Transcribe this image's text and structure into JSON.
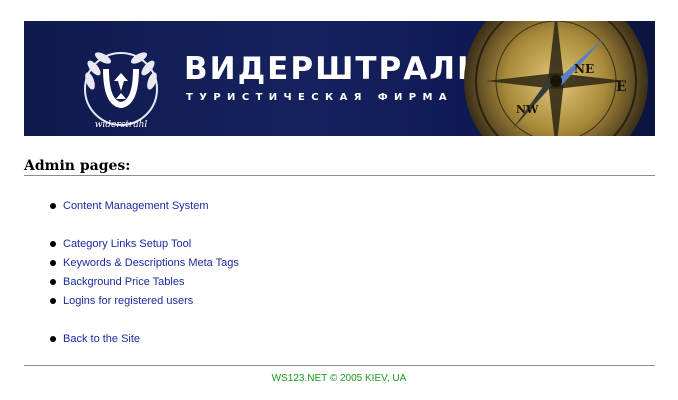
{
  "banner": {
    "title": "ВИДЕРШТРАЛЬ",
    "subtitle": "ТУРИСТИЧЕСКАЯ ФИРМА",
    "logo_text": "widerstrahl",
    "compass_labels": [
      "NE",
      "E",
      "NW"
    ],
    "colors": {
      "background": "#16225f",
      "accent": "#c9a445"
    }
  },
  "admin": {
    "heading": "Admin pages:"
  },
  "links": {
    "group1": [
      {
        "label": "Content Management System"
      }
    ],
    "group2": [
      {
        "label": "Category Links Setup Tool"
      },
      {
        "label": "Keywords & Descriptions Meta Tags"
      },
      {
        "label": "Background Price Tables"
      },
      {
        "label": "Logins for registered users"
      }
    ],
    "group3": [
      {
        "label": "Back to the Site"
      }
    ]
  },
  "footer": {
    "text": "WS123.NET © 2005    KIEV, UA"
  },
  "colors": {
    "link": "#1a2aa0",
    "footer": "#1a9a1a",
    "rule": "#8c8c8c"
  }
}
